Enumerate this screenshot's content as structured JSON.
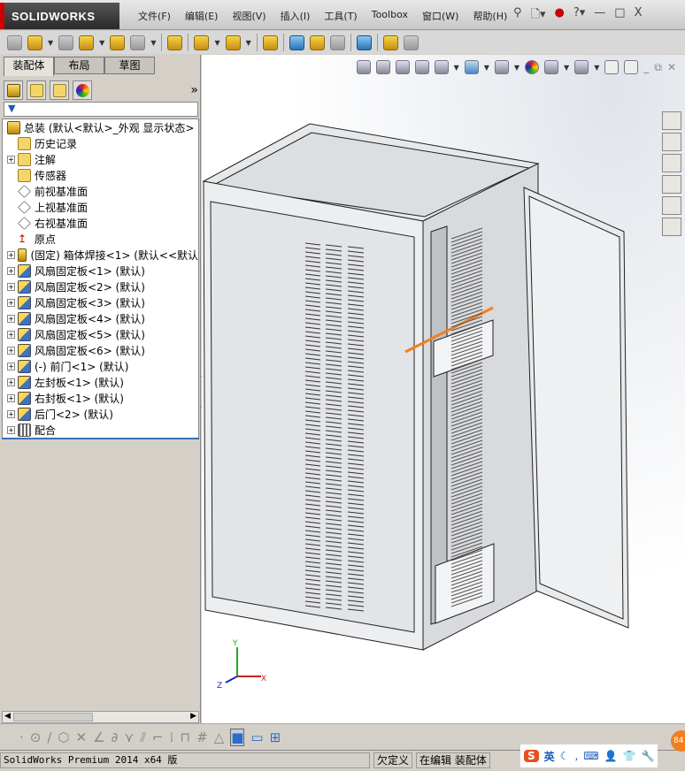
{
  "app": {
    "logo": "SOLIDWORKS"
  },
  "menu": [
    "文件(F)",
    "编辑(E)",
    "视图(V)",
    "插入(I)",
    "工具(T)",
    "Toolbox",
    "窗口(W)",
    "帮助(H)"
  ],
  "window_controls": [
    "—",
    "□",
    "X"
  ],
  "left_panel": {
    "tabs": [
      "装配体",
      "布局",
      "草图"
    ],
    "more": "»",
    "filter_icon": "▼",
    "tree": [
      {
        "label": "总装   (默认<默认>_外观 显示状态>",
        "icon": "assembly",
        "expand": false,
        "indent": 0
      },
      {
        "label": "历史记录",
        "icon": "folder",
        "expand": false,
        "indent": 1
      },
      {
        "label": "注解",
        "icon": "folder",
        "expand": true,
        "indent": 1
      },
      {
        "label": "传感器",
        "icon": "folder",
        "expand": false,
        "indent": 1
      },
      {
        "label": "前视基准面",
        "icon": "plane",
        "expand": false,
        "indent": 1
      },
      {
        "label": "上视基准面",
        "icon": "plane",
        "expand": false,
        "indent": 1
      },
      {
        "label": "右视基准面",
        "icon": "plane",
        "expand": false,
        "indent": 1
      },
      {
        "label": "原点",
        "icon": "origin",
        "expand": false,
        "indent": 1
      },
      {
        "label": "(固定) 箱体焊接<1> (默认<<默认",
        "icon": "assembly",
        "expand": true,
        "indent": 1
      },
      {
        "label": "风扇固定板<1> (默认)",
        "icon": "part",
        "expand": true,
        "indent": 1
      },
      {
        "label": "风扇固定板<2> (默认)",
        "icon": "part",
        "expand": true,
        "indent": 1
      },
      {
        "label": "风扇固定板<3> (默认)",
        "icon": "part",
        "expand": true,
        "indent": 1
      },
      {
        "label": "风扇固定板<4> (默认)",
        "icon": "part",
        "expand": true,
        "indent": 1
      },
      {
        "label": "风扇固定板<5> (默认)",
        "icon": "part",
        "expand": true,
        "indent": 1
      },
      {
        "label": "风扇固定板<6> (默认)",
        "icon": "part",
        "expand": true,
        "indent": 1
      },
      {
        "label": "(-) 前门<1> (默认)",
        "icon": "part",
        "expand": true,
        "indent": 1
      },
      {
        "label": "左封板<1> (默认)",
        "icon": "part",
        "expand": true,
        "indent": 1
      },
      {
        "label": "右封板<1> (默认)",
        "icon": "part",
        "expand": true,
        "indent": 1
      },
      {
        "label": "后门<2> (默认)",
        "icon": "part",
        "expand": true,
        "indent": 1
      },
      {
        "label": "配合",
        "icon": "mate",
        "expand": true,
        "indent": 1
      }
    ]
  },
  "triad": {
    "x": "X",
    "y": "Y",
    "z": "Z"
  },
  "status": {
    "product": "SolidWorks Premium 2014 x64 版",
    "state": "欠定义",
    "mode": "在编辑 装配体"
  },
  "ime": {
    "lang": "英",
    "badge": "84"
  },
  "colors": {
    "accent": "#3a6fb5",
    "orange": "#f08020"
  }
}
